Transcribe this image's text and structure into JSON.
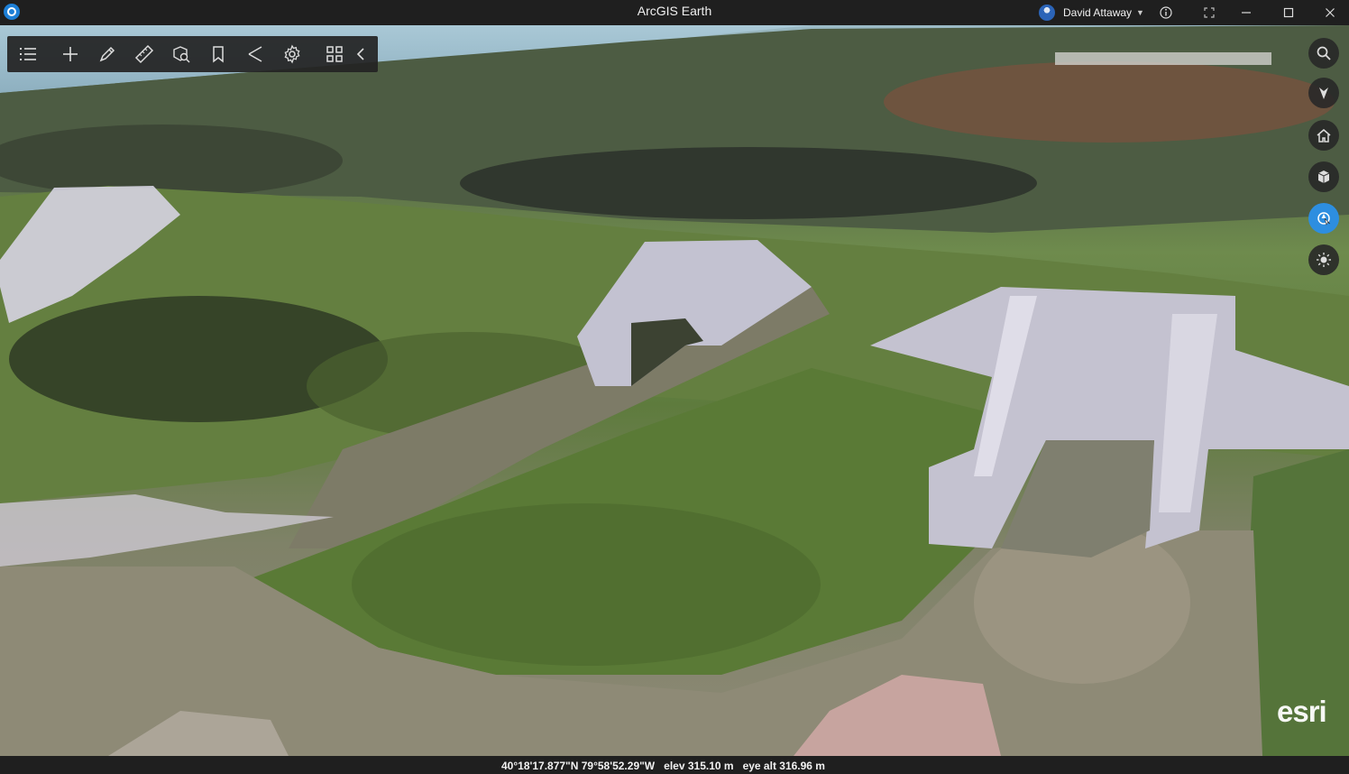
{
  "window": {
    "title": "ArcGIS Earth",
    "user_name": "David Attaway"
  },
  "toolbar": {
    "items": [
      {
        "icon": "contents-list-icon"
      },
      {
        "icon": "add-icon"
      },
      {
        "icon": "draw-icon"
      },
      {
        "icon": "measure-icon"
      },
      {
        "icon": "analysis-icon"
      },
      {
        "icon": "bookmark-icon"
      },
      {
        "icon": "share-icon"
      },
      {
        "icon": "settings-icon"
      },
      {
        "icon": "apps-icon"
      },
      {
        "icon": "collapse-icon"
      }
    ]
  },
  "navigation": {
    "items": [
      {
        "icon": "search-icon",
        "active": false
      },
      {
        "icon": "compass-icon",
        "active": false
      },
      {
        "icon": "home-icon",
        "active": false
      },
      {
        "icon": "3d-view-icon",
        "active": false
      },
      {
        "icon": "navigation-mode-icon",
        "active": true
      },
      {
        "icon": "sun-icon",
        "active": false
      }
    ]
  },
  "map": {
    "attribution": "esri"
  },
  "status": {
    "latlon": "40°18'17.877\"N 79°58'52.29\"W",
    "elev": "elev 315.10 m",
    "eye_alt": "eye alt 316.96 m"
  },
  "colors": {
    "titlebar": "#1f1f1f",
    "toolbar": "#232323",
    "accent": "#2d8ee0",
    "grass": "#5e7b3d",
    "water": "#8c8975",
    "concrete": "#b8b8c6"
  }
}
